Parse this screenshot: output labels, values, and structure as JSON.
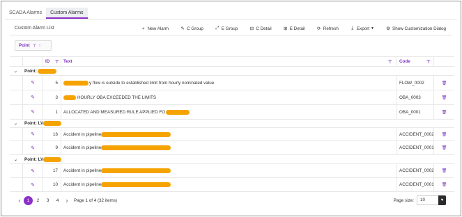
{
  "tabs": [
    "SCADA Alarms",
    "Custom Alarms"
  ],
  "title": "Custom Alarm List",
  "toolbar": {
    "new_alarm": "New Alarm",
    "c_group": "C Group",
    "e_group": "E Group",
    "c_detail": "C Detail",
    "e_detail": "E Detail",
    "refresh": "Refresh",
    "export": "Export",
    "customization": "Show Customization Dialog"
  },
  "group_panel": {
    "label": "Point"
  },
  "columns": {
    "id": "ID",
    "text": "Text",
    "code": "Code"
  },
  "groups": [
    {
      "label": "Point:",
      "rows": [
        {
          "id": "5",
          "text": "y flow is outside to established limit from hourly nominated value",
          "code": "FLOW_0002"
        },
        {
          "id": "3",
          "text": "HOURLY OBA EXCEEDED THE LIMITS",
          "code": "OBA_0003"
        },
        {
          "id": "1",
          "text": "ALLOCATED AND MEASURED RULE APPLIED FO",
          "code": "OBA_0001"
        }
      ]
    },
    {
      "label": "Point: LV",
      "rows": [
        {
          "id": "16",
          "text": "Accident in pipeline",
          "code": "ACCIDENT_0002"
        },
        {
          "id": "9",
          "text": "Accident in pipeline",
          "code": "ACCIDENT_0001"
        }
      ]
    },
    {
      "label": "Point: LV",
      "rows": [
        {
          "id": "17",
          "text": "Accident in pipeline",
          "code": "ACCIDENT_0002"
        },
        {
          "id": "10",
          "text": "Accident in pipeline",
          "code": "ACCIDENT_0001"
        }
      ]
    }
  ],
  "pager": {
    "pages": [
      "1",
      "2",
      "3",
      "4"
    ],
    "current": "1",
    "info": "Page 1 of 4 (32 items)",
    "size_label": "Page size:",
    "size_value": "10"
  },
  "colors": {
    "accent": "#8b2fc9",
    "redaction": "#f5a300"
  }
}
